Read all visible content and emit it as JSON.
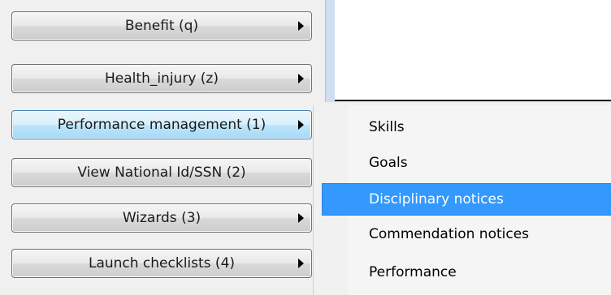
{
  "buttons": [
    {
      "label": "Benefit (q)",
      "has_arrow": true
    },
    {
      "label": "Health_injury (z)",
      "has_arrow": true
    },
    {
      "label": "Performance management (1)",
      "has_arrow": true,
      "active": true
    },
    {
      "label": "View National Id/SSN (2)",
      "has_arrow": false
    },
    {
      "label": "Wizards (3)",
      "has_arrow": true
    },
    {
      "label": "Launch checklists (4)",
      "has_arrow": true
    }
  ],
  "submenu": {
    "items": [
      {
        "label": "Skills"
      },
      {
        "label": "Goals"
      },
      {
        "label": "Disciplinary notices",
        "highlighted": true
      },
      {
        "label": "Commendation notices"
      },
      {
        "label": "Performance"
      }
    ]
  },
  "colors": {
    "highlight": "#3399ff",
    "active_button_border": "#3c7fb1"
  }
}
